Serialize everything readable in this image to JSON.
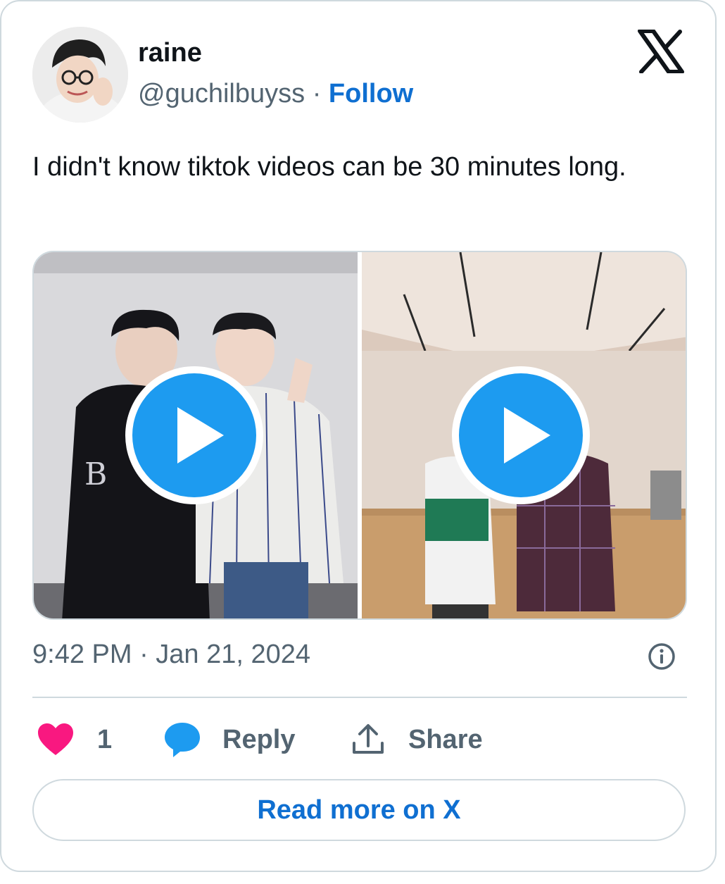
{
  "author": {
    "name": "raine",
    "handle": "@guchilbuyss",
    "separator": "·",
    "follow_label": "Follow"
  },
  "tweet": {
    "text": "I didn't know tiktok videos can be 30 minutes long.",
    "timestamp": "9:42 PM · Jan 21, 2024"
  },
  "media": [
    {
      "kind": "video",
      "icon": "play-icon"
    },
    {
      "kind": "video",
      "icon": "play-icon"
    }
  ],
  "actions": {
    "like_count": "1",
    "reply_label": "Reply",
    "share_label": "Share"
  },
  "read_more_label": "Read more on X",
  "colors": {
    "accent": "#1d9bf0",
    "link": "#0f6fd1",
    "like": "#f91880",
    "muted": "#536471",
    "border": "#cfd9de"
  }
}
